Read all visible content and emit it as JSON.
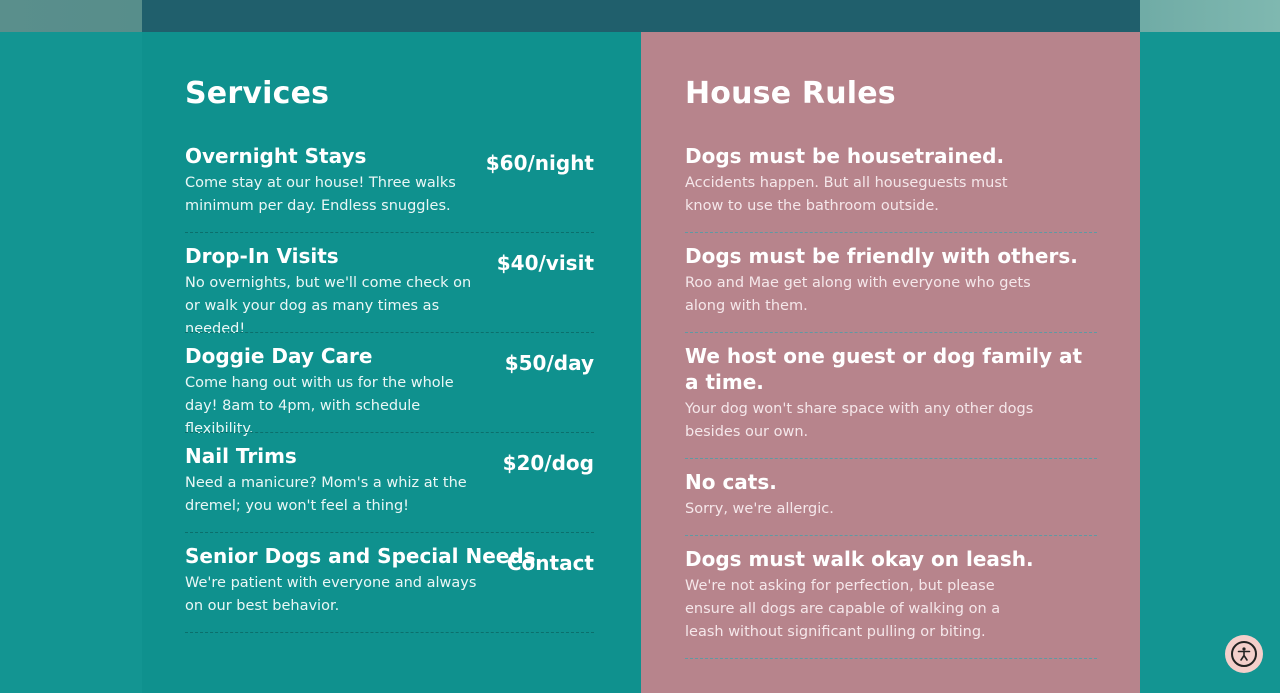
{
  "services": {
    "title": "Services",
    "items": [
      {
        "name": "Overnight Stays",
        "price": "$60/night",
        "description": "Come stay at our house! Three walks minimum per day. Endless snuggles."
      },
      {
        "name": "Drop-In Visits",
        "price": "$40/visit",
        "description": "No overnights, but we'll come check on or walk your dog as many times as needed!"
      },
      {
        "name": "Doggie Day Care",
        "price": "$50/day",
        "description": "Come hang out with us for the whole day! 8am to 4pm, with schedule flexibility."
      },
      {
        "name": "Nail Trims",
        "price": "$20/dog",
        "description": "Need a manicure? Mom's a whiz at the dremel; you won't feel a thing!"
      },
      {
        "name": "Senior Dogs and Special Needs",
        "price": "Contact",
        "description": "We're patient with everyone and always on our best behavior."
      }
    ]
  },
  "house_rules": {
    "title": "House Rules",
    "items": [
      {
        "name": "Dogs must be housetrained.",
        "description": "Accidents happen. But all houseguests must know to use the bathroom outside."
      },
      {
        "name": "Dogs must be friendly with others.",
        "description": "Roo and Mae get along with everyone who gets along with them."
      },
      {
        "name": "We host one guest or dog family at a time.",
        "description": "Your dog won't share space with any other dogs besides our own."
      },
      {
        "name": "No cats.",
        "description": "Sorry, we're allergic."
      },
      {
        "name": "Dogs must walk okay on leash.",
        "description": "We're not asking for perfection, but please ensure all dogs are capable of walking on a leash without significant pulling or biting."
      }
    ]
  },
  "icons": {
    "accessibility": "accessibility-icon"
  },
  "colors": {
    "services_bg": "#0f918e",
    "rules_bg": "#b7848c",
    "page_bg": "#139592"
  }
}
